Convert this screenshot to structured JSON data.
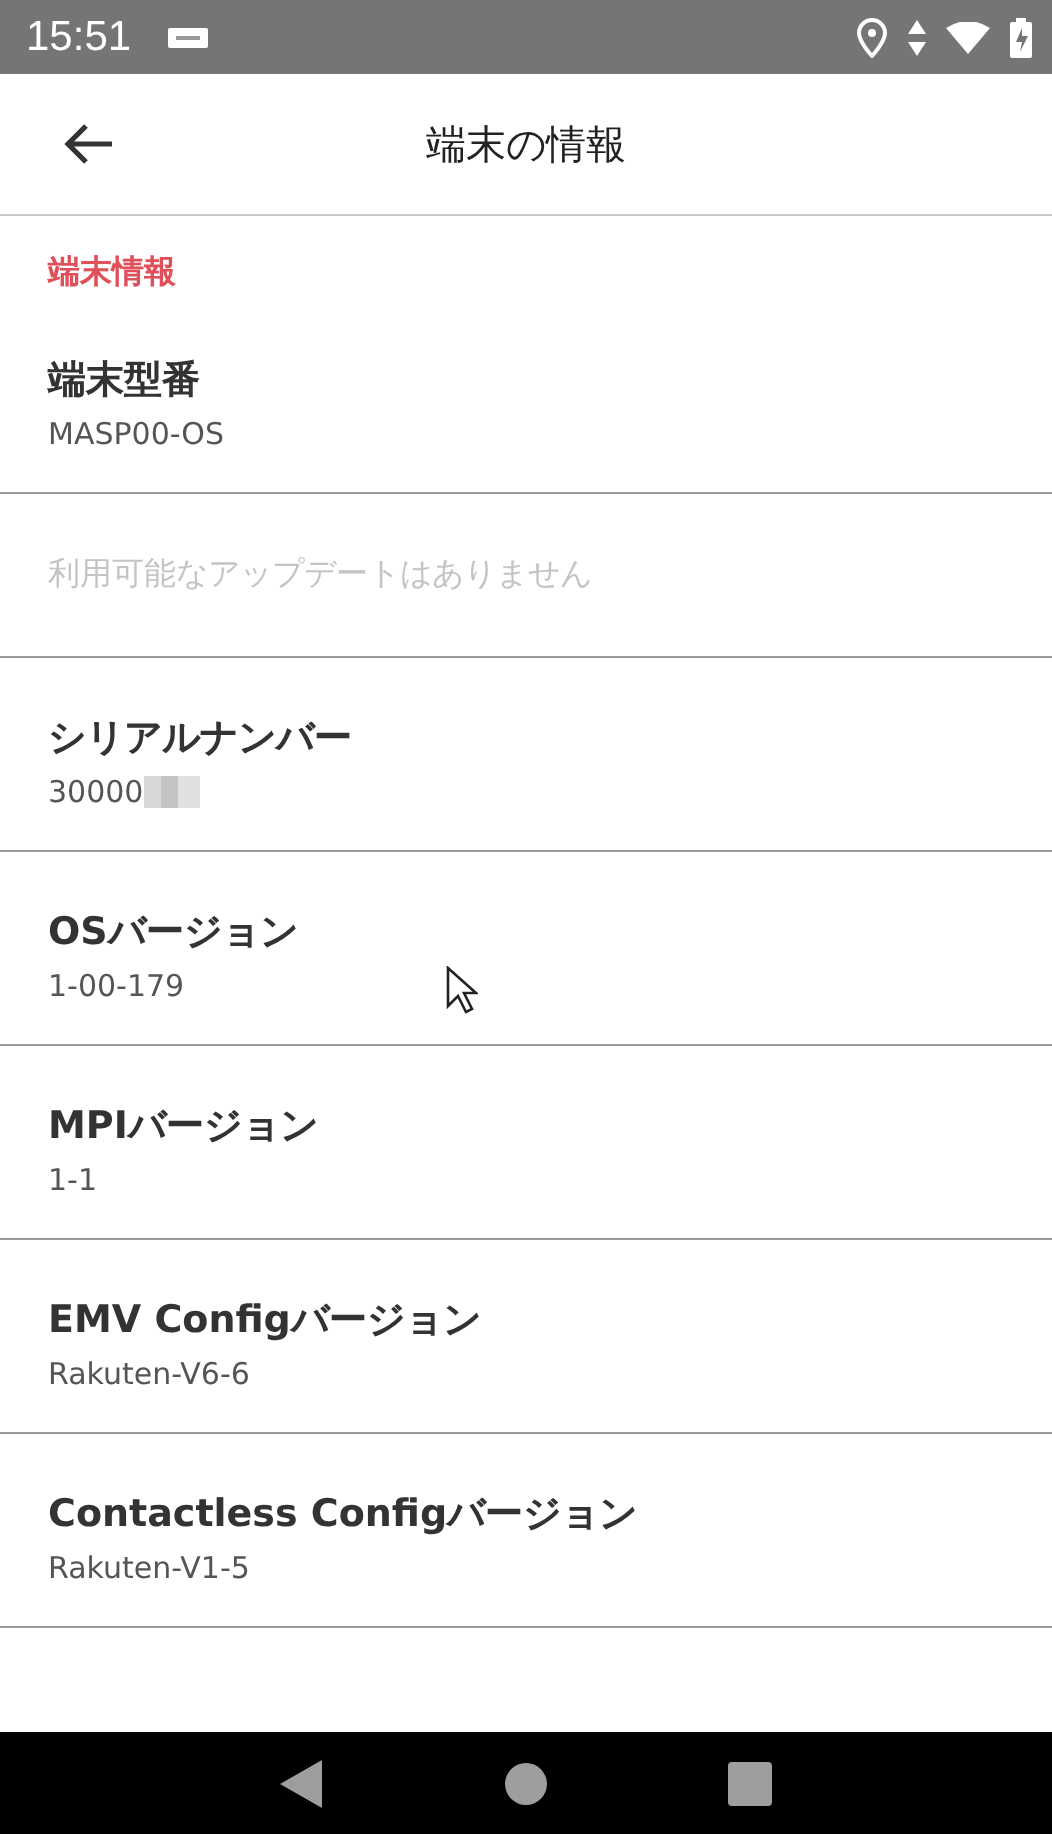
{
  "status_bar": {
    "time": "15:51"
  },
  "toolbar": {
    "title": "端末の情報"
  },
  "section": {
    "title": "端末情報"
  },
  "rows": [
    {
      "kind": "item",
      "title": "端末型番",
      "value": "MASP00-OS"
    },
    {
      "kind": "notice",
      "title": "利用可能なアップデートはありません",
      "disabled": true
    },
    {
      "kind": "item",
      "title": "シリアルナンバー",
      "value": "30000",
      "redacted": true
    },
    {
      "kind": "item",
      "title": "OSバージョン",
      "value": "1-00-179"
    },
    {
      "kind": "item",
      "title": "MPIバージョン",
      "value": "1-1"
    },
    {
      "kind": "item",
      "title": "EMV Configバージョン",
      "value": "Rakuten-V6-6"
    },
    {
      "kind": "item",
      "title": "Contactless Configバージョン",
      "value": "Rakuten-V1-5"
    }
  ]
}
